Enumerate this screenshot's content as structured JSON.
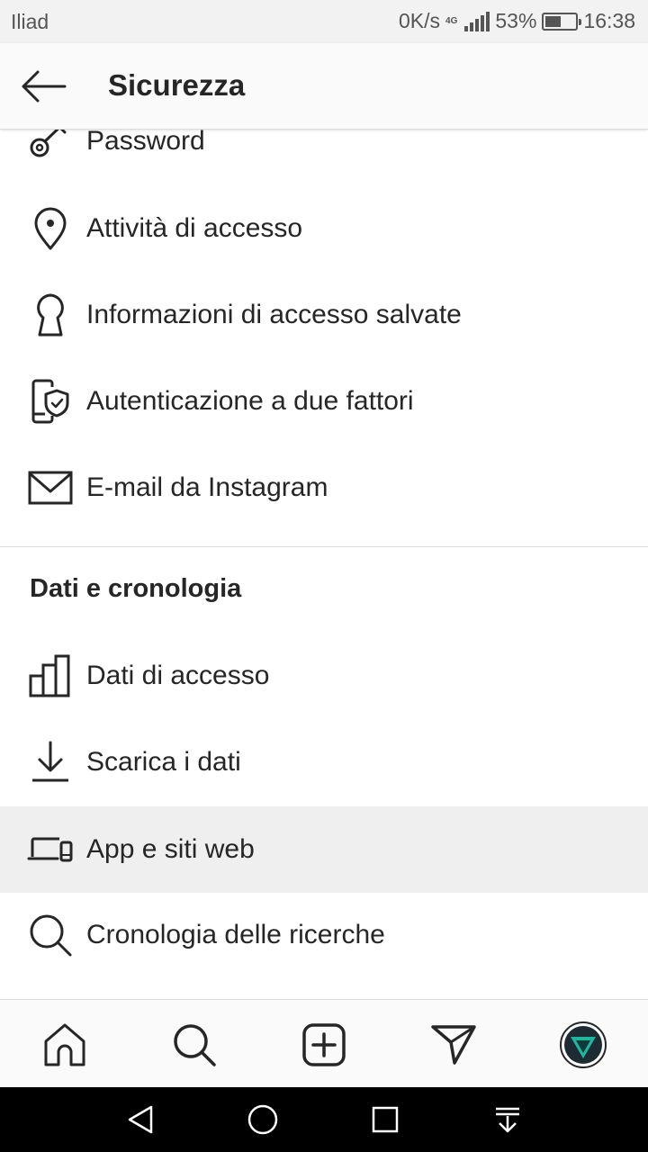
{
  "status_bar": {
    "carrier": "Iliad",
    "speed": "0K/s",
    "network": "4G",
    "battery": "53%",
    "battery_level": 0.53,
    "time": "16:38"
  },
  "header": {
    "title": "Sicurezza"
  },
  "security_items": [
    {
      "label": "Password",
      "icon": "key-icon"
    },
    {
      "label": "Attività di accesso",
      "icon": "location-pin-icon"
    },
    {
      "label": "Informazioni di accesso salvate",
      "icon": "keyhole-icon"
    },
    {
      "label": "Autenticazione a due fattori",
      "icon": "phone-shield-icon"
    },
    {
      "label": "E-mail da Instagram",
      "icon": "mail-icon"
    }
  ],
  "data_section": {
    "title": "Dati e cronologia",
    "items": [
      {
        "label": "Dati di accesso",
        "icon": "bar-chart-icon"
      },
      {
        "label": "Scarica i dati",
        "icon": "download-icon"
      },
      {
        "label": "App e siti web",
        "icon": "devices-icon",
        "highlighted": true
      },
      {
        "label": "Cronologia delle ricerche",
        "icon": "search-icon"
      }
    ]
  },
  "bottom_nav": [
    "home-icon",
    "search-icon",
    "add-post-icon",
    "direct-message-icon",
    "profile-avatar"
  ],
  "colors": {
    "text": "#262626",
    "divider": "#dbdbdb",
    "highlight": "#efefef",
    "statusbar": "#f2f2f2"
  }
}
